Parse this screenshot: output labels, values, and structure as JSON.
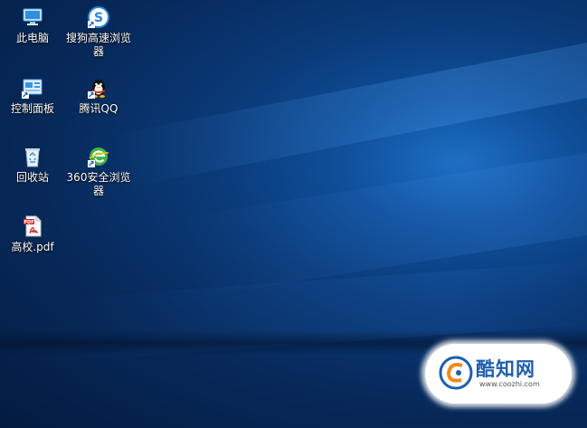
{
  "desktop": {
    "icons": [
      {
        "id": "this-pc",
        "label": "此电脑",
        "icon": "computer-icon"
      },
      {
        "id": "sogou-browser",
        "label": "搜狗高速浏览器",
        "icon": "sogou-browser-icon"
      },
      {
        "id": "control-panel",
        "label": "控制面板",
        "icon": "control-panel-icon"
      },
      {
        "id": "tencent-qq",
        "label": "腾讯QQ",
        "icon": "qq-penguin-icon"
      },
      {
        "id": "recycle-bin",
        "label": "回收站",
        "icon": "recycle-bin-icon"
      },
      {
        "id": "360-browser",
        "label": "360安全浏览器",
        "icon": "360-browser-icon"
      },
      {
        "id": "gaoxiao-pdf",
        "label": "高校.pdf",
        "icon": "pdf-file-icon"
      }
    ]
  },
  "watermark": {
    "brand": "酷知网",
    "url": "www.coozhi.com"
  },
  "colors": {
    "wallpaper_dark": "#041b3f",
    "wallpaper_light": "#1d6fc4",
    "label_text": "#ffffff",
    "watermark_brand": "#1d5fae"
  }
}
